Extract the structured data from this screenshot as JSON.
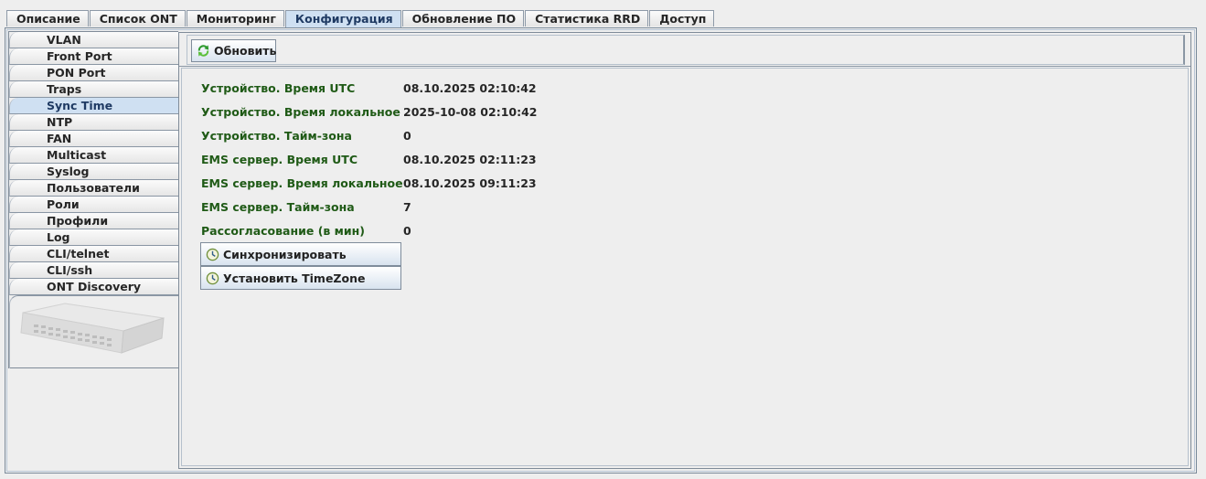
{
  "tabs": [
    "Описание",
    "Список ONT",
    "Мониторинг",
    "Конфигурация",
    "Обновление ПО",
    "Статистика RRD",
    "Доступ"
  ],
  "active_tab": "Конфигурация",
  "nav": {
    "items": [
      "VLAN",
      "Front Port",
      "PON Port",
      "Traps",
      "Sync Time",
      "NTP",
      "FAN",
      "Multicast",
      "Syslog",
      "Пользователи",
      "Роли",
      "Профили",
      "Log",
      "CLI/telnet",
      "CLI/ssh",
      "ONT Discovery"
    ],
    "selected": "Sync Time",
    "device_image": "olt-switch-image"
  },
  "toolbar": {
    "refresh_label": "Обновить",
    "refresh_icon": "refresh-icon"
  },
  "sync_time": {
    "rows": [
      {
        "label": "Устройство. Время UTC",
        "value": "08.10.2025 02:10:42"
      },
      {
        "label": "Устройство. Время локальное",
        "value": "2025-10-08 02:10:42"
      },
      {
        "label": "Устройство. Тайм-зона",
        "value": "0"
      },
      {
        "label": "EMS сервер. Время UTC",
        "value": "08.10.2025 02:11:23"
      },
      {
        "label": "EMS сервер. Время локальное",
        "value": "08.10.2025 09:11:23"
      },
      {
        "label": "EMS сервер. Тайм-зона",
        "value": "7"
      },
      {
        "label": "Рассогласование (в мин)",
        "value": "0"
      }
    ],
    "sync_button_label": "Синхронизировать",
    "timezone_button_label": "Установить TimeZone",
    "clock_icon": "clock-icon"
  },
  "colors": {
    "label_green": "#1f5a16",
    "selection_blue": "#cfe0f2",
    "border": "#7f8b98"
  }
}
